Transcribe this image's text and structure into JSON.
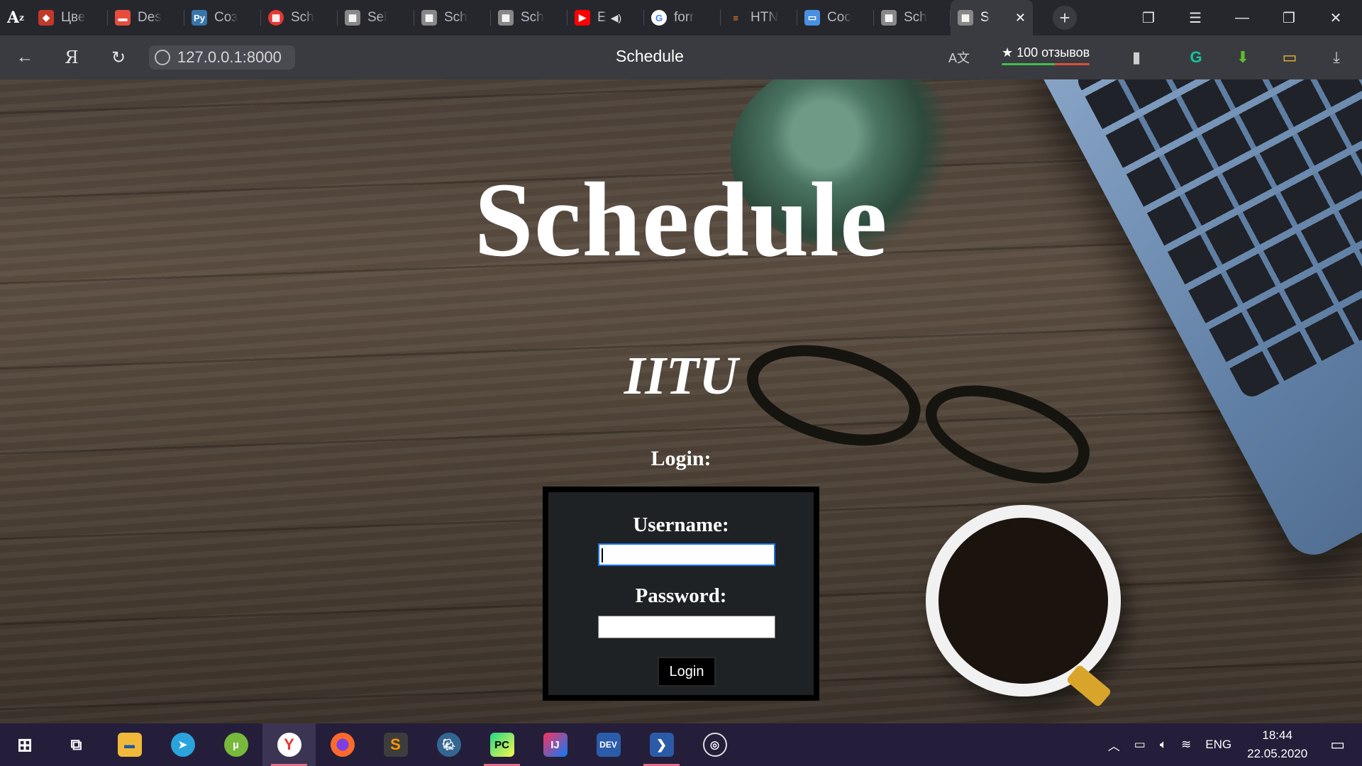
{
  "browser": {
    "tabs": [
      {
        "label": "Цве",
        "icon": "bag-icon",
        "color": "#c0392b"
      },
      {
        "label": "Des",
        "icon": "clapper-icon",
        "color": "#e74c3c"
      },
      {
        "label": "Соз",
        "icon": "python-icon",
        "color": "#3776ab"
      },
      {
        "label": "Sch",
        "icon": "calendar-icon",
        "color": "#e53935"
      },
      {
        "label": "Sel",
        "icon": "table-icon",
        "color": "#888888"
      },
      {
        "label": "Sch",
        "icon": "table-icon",
        "color": "#888888"
      },
      {
        "label": "Sch",
        "icon": "table-icon",
        "color": "#888888"
      },
      {
        "label": "E",
        "icon": "youtube-icon",
        "color": "#ff0000"
      },
      {
        "label": "forr",
        "icon": "google-icon",
        "color": "#4285f4"
      },
      {
        "label": "HTN",
        "icon": "stackoverflow-icon",
        "color": "#f48024"
      },
      {
        "label": "Coc",
        "icon": "chat-icon",
        "color": "#4a90e2"
      },
      {
        "label": "Sch",
        "icon": "table-icon",
        "color": "#888888"
      }
    ],
    "active_tab": {
      "label": "S",
      "icon": "table-icon"
    },
    "address": "127.0.0.1:8000",
    "page_title": "Schedule",
    "reviews": "★ 100 отзывов"
  },
  "page": {
    "title": "Schedule",
    "subtitle": "IITU",
    "login_heading": "Login:",
    "form": {
      "username_label": "Username:",
      "username_value": "",
      "password_label": "Password:",
      "password_value": "",
      "submit_label": "Login"
    }
  },
  "taskbar": {
    "apps": [
      "windows-start",
      "task-view",
      "file-explorer",
      "telegram",
      "utorrent",
      "yandex-browser",
      "firefox",
      "sublime-text",
      "pgadmin",
      "pycharm",
      "intellij",
      "devcpp",
      "powershell",
      "obs"
    ],
    "active_app": "yandex-browser",
    "language": "ENG",
    "time": "18:44",
    "date": "22.05.2020"
  },
  "colors": {
    "accent_focus": "#1a73e8",
    "taskbar_bg": "#241e3a",
    "tab_strip_bg": "#26272d",
    "address_bar_bg": "#3a3b41",
    "form_bg": "#1f2225"
  }
}
